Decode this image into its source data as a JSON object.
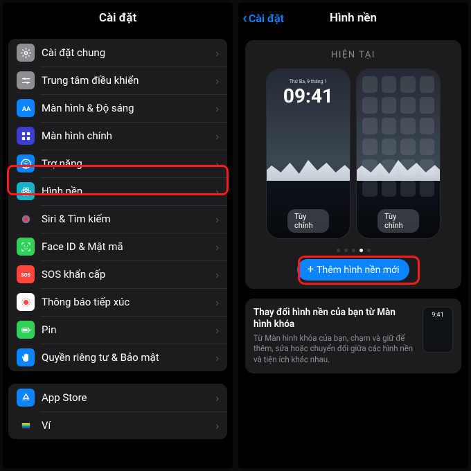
{
  "left": {
    "title": "Cài đặt",
    "items": [
      {
        "label": "Cài đặt chung",
        "icon": "gear-icon",
        "bg": "#8e8e93"
      },
      {
        "label": "Trung tâm điều khiển",
        "icon": "sliders-icon",
        "bg": "#8e8e93"
      },
      {
        "label": "Màn hình & Độ sáng",
        "icon": "display-icon",
        "bg": "#0a84ff"
      },
      {
        "label": "Màn hình chính",
        "icon": "home-grid-icon",
        "bg": "#3d3dcf"
      },
      {
        "label": "Trợ năng",
        "icon": "accessibility-icon",
        "bg": "#0a84ff"
      },
      {
        "label": "Hình nền",
        "icon": "atom-icon",
        "bg": "#17b1c8"
      },
      {
        "label": "Siri & Tìm kiếm",
        "icon": "siri-icon",
        "bg": "#1c1c1e"
      },
      {
        "label": "Face ID & Mật mã",
        "icon": "faceid-icon",
        "bg": "#30d158"
      },
      {
        "label": "SOS khẩn cấp",
        "icon": "sos-icon",
        "bg": "#ff453a"
      },
      {
        "label": "Thông báo tiếp xúc",
        "icon": "exposure-icon",
        "bg": "#ffffff"
      },
      {
        "label": "Pin",
        "icon": "battery-icon",
        "bg": "#30d158"
      },
      {
        "label": "Quyền riêng tư & Bảo mật",
        "icon": "hand-icon",
        "bg": "#0a84ff"
      }
    ],
    "group2": [
      {
        "label": "App Store",
        "icon": "appstore-icon",
        "bg": "#0a84ff"
      },
      {
        "label": "Ví",
        "icon": "wallet-icon",
        "bg": "#1c1c1e"
      }
    ],
    "highlight_index": 5
  },
  "right": {
    "back": "Cài đặt",
    "title": "Hình nền",
    "current_label": "HIỆN TẠI",
    "lockscreen": {
      "date": "Thứ Ba, 9 tháng 1",
      "time": "09:41",
      "customize": "Tùy chỉnh"
    },
    "homescreen": {
      "customize": "Tùy chỉnh"
    },
    "page_index": 3,
    "page_count": 5,
    "add_btn": "Thêm hình nền mới",
    "info": {
      "title": "Thay đổi hình nền của bạn từ Màn hình khóa",
      "desc": "Từ Màn hình khóa của bạn, chạm và giữ để thêm, sửa hoặc chuyển đổi giữa các hình nền và tiện ích khác nhau.",
      "thumb_time": "9:41"
    }
  },
  "colors": {
    "accent": "#0a84ff",
    "highlight": "#ff1a1a"
  }
}
